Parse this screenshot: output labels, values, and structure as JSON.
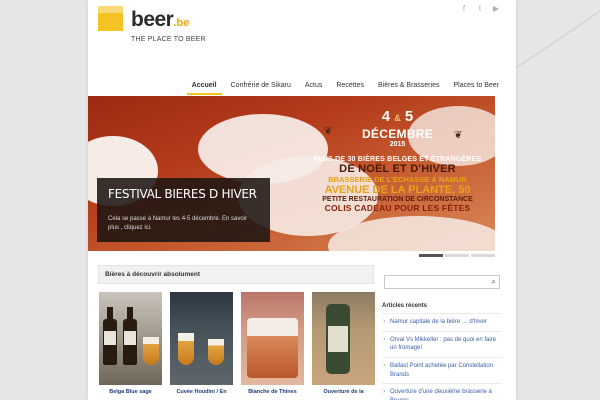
{
  "brand": {
    "name": "beer",
    "tld": ".be",
    "tagline": "THE PLACE TO BEER",
    "accent_color": "#f6c324"
  },
  "social": [
    "facebook-icon",
    "twitter-icon",
    "youtube-icon"
  ],
  "social_glyphs": {
    "facebook": "f",
    "twitter": "t",
    "youtube": "▶"
  },
  "nav": {
    "items": [
      "Accueil",
      "Confrérie de Sikaru",
      "Actus",
      "Recettes",
      "Bières & Brasseries",
      "Places to Beer"
    ],
    "active_index": 0
  },
  "slider": {
    "caption_title": "FESTIVAL BIERES D HIVER",
    "caption_text": "Cela se passe à Namur les 4-5 décembre. En savoir plus , cliquez ici.",
    "poster": {
      "num_left": "4",
      "amp": "&",
      "num_right": "5",
      "month": "DÉCEMBRE",
      "year": "2015",
      "line1": "PLUS DE 30 BIÈRES BELGES ET ÉTRANGÈRES",
      "line2": "DE NOËL ET D'HIVER",
      "line3": "BRASSERIE DE L'ECHASSE À NAMUR",
      "line4": "AVENUE DE LA PLANTE, 50",
      "line5": "PETITE RESTAURATION DE CIRCONSTANCE",
      "line6": "COLIS CADEAU POUR LES FÊTES"
    },
    "slide_count": 3,
    "active_slide": 0
  },
  "section": {
    "title": "Bières à découvrir absolument",
    "items": [
      {
        "label": "Belga Blue sage"
      },
      {
        "label": "Cuvée Houdini / En"
      },
      {
        "label": "Blanche de Thines"
      },
      {
        "label": "Ouverture de la"
      }
    ]
  },
  "sidebar": {
    "search_placeholder": "",
    "search_icon": "search-icon",
    "recent_title": "Articles récents",
    "recent": [
      "Namur capitale de la bière … d'hiver",
      "Orval Vs Mikkeller : pas de quoi en faire un fromage!",
      "Ballast Point achetée par Constellation Brands",
      "Ouverture d'une deuxième brasserie à Bruges"
    ]
  }
}
